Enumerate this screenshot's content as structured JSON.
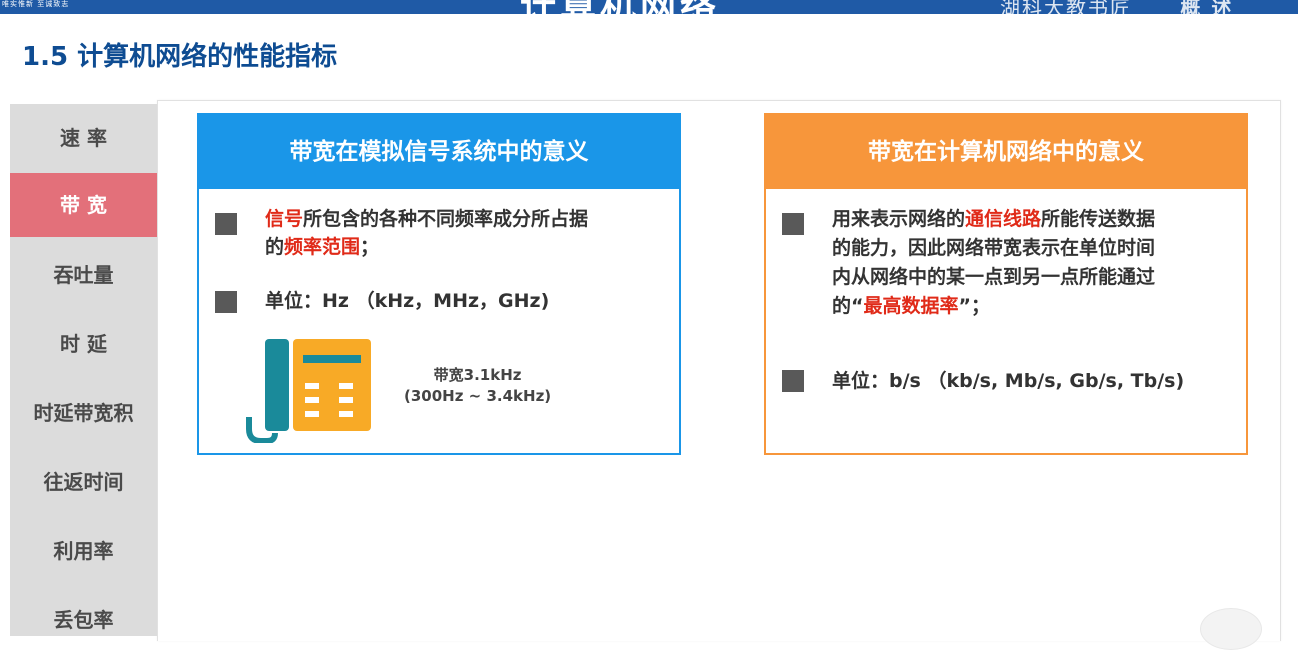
{
  "banner": {
    "motto": "唯实惟新  至诚致志",
    "title": "计算机网络",
    "institution": "湖科大教书匠",
    "chapter": "概  述"
  },
  "page_title": "1.5 计算机网络的性能指标",
  "sidebar": {
    "items": [
      {
        "label": "速 率",
        "active": false
      },
      {
        "label": "带 宽",
        "active": true
      },
      {
        "label": "吞吐量",
        "active": false
      },
      {
        "label": "时 延",
        "active": false
      },
      {
        "label": "时延带宽积",
        "active": false
      },
      {
        "label": "往返时间",
        "active": false
      },
      {
        "label": "利用率",
        "active": false
      },
      {
        "label": "丢包率",
        "active": false
      }
    ]
  },
  "analog_card": {
    "title": "带宽在模拟信号系统中的意义",
    "bullet1": {
      "line1_red": "信号",
      "line1_rest": "所包含的各种不同频率成分所占据",
      "line2_pre": "的",
      "line2_red": "频率范围",
      "line2_post": "；"
    },
    "bullet2": "单位：Hz （kHz，MHz，GHz)",
    "caption_line1": "带宽3.1kHz",
    "caption_line2": "(300Hz ~ 3.4kHz)"
  },
  "network_card": {
    "title": "带宽在计算机网络中的意义",
    "bullet1": {
      "line1_pre": "用来表示网络的",
      "line1_red": "通信线路",
      "line1_post": "所能传送数据",
      "line2": "的能力，因此网络带宽表示在单位时间",
      "line3": "内从网络中的某一点到另一点所能通过",
      "line4_pre": "的“",
      "line4_red": "最高数据率",
      "line4_post": "”；"
    },
    "bullet2": "单位：b/s （kb/s, Mb/s, Gb/s, Tb/s)"
  },
  "colors": {
    "blue_accent": "#1a96e8",
    "orange_accent": "#f7963b",
    "highlight_red": "#e02a18",
    "active_tab": "#e3707a",
    "title_blue": "#0e4c92",
    "phone_teal": "#1a8a9a",
    "phone_body": "#f8aa26"
  },
  "icons": [
    "telephone-icon"
  ]
}
